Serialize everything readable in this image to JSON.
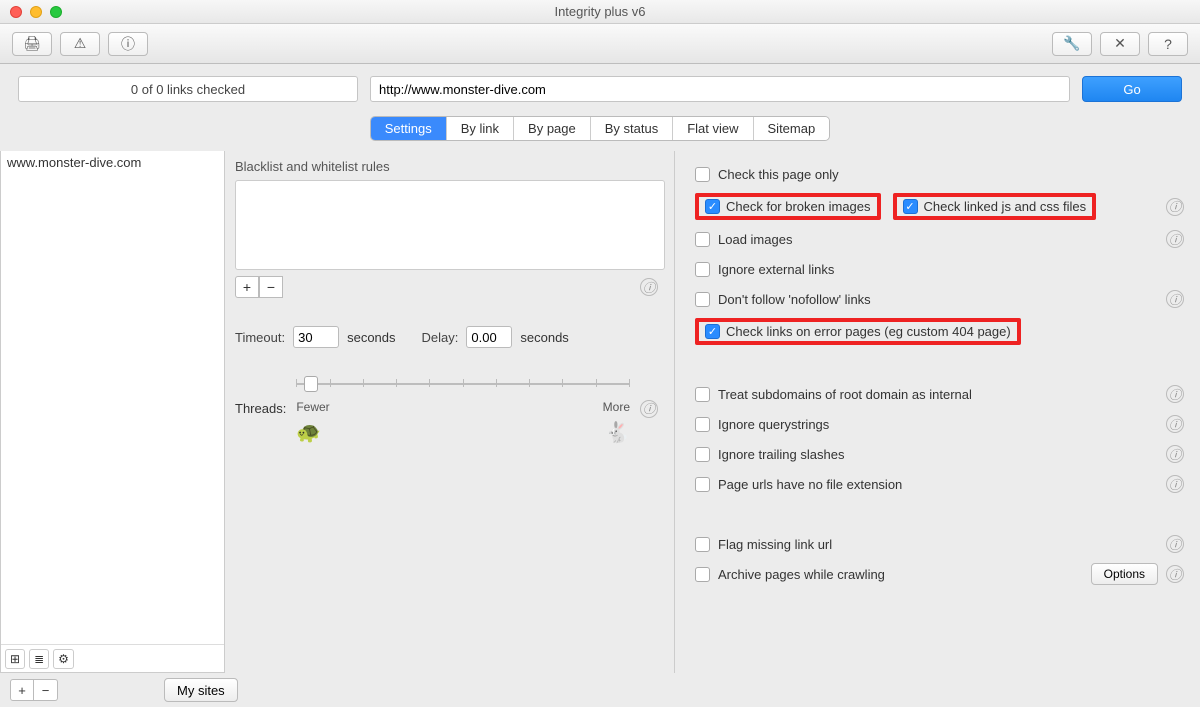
{
  "window": {
    "title": "Integrity plus v6"
  },
  "toolbar_icons": {
    "print": "print-icon",
    "warn": "warning-icon",
    "info": "info-icon",
    "wrench": "wrench-icon",
    "tools": "tools-icon",
    "help": "help-icon"
  },
  "status": {
    "text": "0 of 0 links checked"
  },
  "url": {
    "value": "http://www.monster-dive.com"
  },
  "go": {
    "label": "Go"
  },
  "tabs": {
    "settings": "Settings",
    "bylink": "By link",
    "bypage": "By page",
    "bystatus": "By status",
    "flat": "Flat view",
    "sitemap": "Sitemap"
  },
  "sidebar": {
    "item0": "www.monster-dive.com"
  },
  "blw": {
    "label": "Blacklist and whitelist rules"
  },
  "timeout": {
    "label": "Timeout:",
    "value": "30",
    "unit": "seconds"
  },
  "delay": {
    "label": "Delay:",
    "value": "0.00",
    "unit": "seconds"
  },
  "threads": {
    "label": "Threads:",
    "fewer": "Fewer",
    "more": "More"
  },
  "checks": {
    "page_only": "Check this page only",
    "broken_images": "Check for broken images",
    "linked_assets": "Check linked js and css files",
    "load_images": "Load images",
    "ignore_external": "Ignore external links",
    "nofollow": "Don't follow 'nofollow' links",
    "error_pages": "Check links on error pages (eg custom 404 page)",
    "subdomains": "Treat subdomains of root domain as internal",
    "querystrings": "Ignore querystrings",
    "trailing": "Ignore trailing slashes",
    "no_ext": "Page urls have no file extension",
    "missing_url": "Flag missing link url",
    "archive": "Archive pages while crawling"
  },
  "options": {
    "label": "Options"
  },
  "mysites": {
    "label": "My sites"
  },
  "glyph": {
    "plus": "+",
    "minus": "−",
    "print": "🖨",
    "warn": "⚠",
    "info": "ⓘ",
    "wrench": "🔧",
    "tools": "✕",
    "help": "?",
    "grid": "⊞",
    "list": "≣",
    "gear": "⚙",
    "turtle": "🐢",
    "rabbit": "🐇"
  }
}
